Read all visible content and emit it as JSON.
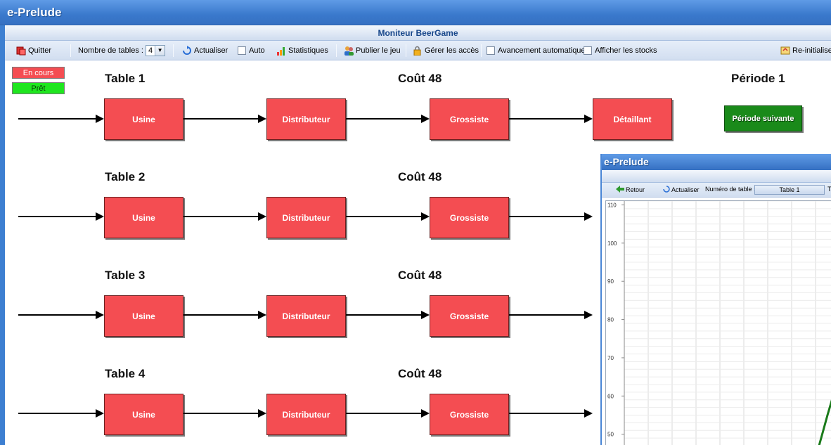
{
  "app": {
    "title": "e-Prelude",
    "subtitle": "Moniteur BeerGame"
  },
  "toolbar": {
    "quit": "Quitter",
    "tables_label": "Nombre de tables :",
    "tables_value": "4",
    "refresh": "Actualiser",
    "auto": "Auto",
    "stats": "Statistiques",
    "publish": "Publier le jeu",
    "access": "Gérer les accès",
    "auto_advance": "Avancement automatique",
    "show_stock": "Afficher les stocks",
    "reset": "Re-initialiser"
  },
  "legend": {
    "in_progress": "En cours",
    "ready": "Prêt"
  },
  "period": {
    "label": "Période 1",
    "next_button": "Période suivante"
  },
  "tables": [
    {
      "label": "Table 1",
      "cost": "Coût 48"
    },
    {
      "label": "Table 2",
      "cost": "Coût 48"
    },
    {
      "label": "Table 3",
      "cost": "Coût 48"
    },
    {
      "label": "Table 4",
      "cost": "Coût 48"
    }
  ],
  "roles": [
    "Usine",
    "Distributeur",
    "Grossiste",
    "Détaillant"
  ],
  "colors": {
    "role_box": "#f44d52",
    "ready": "#1fe61f",
    "next_button": "#1a8a1a",
    "header": "#3a79cc"
  },
  "overlay": {
    "title": "e-Prelude",
    "back": "Retour",
    "refresh": "Actualiser",
    "table_number_label": "Numéro de table :",
    "table_selected": "Table 1",
    "tab_partial": "Ta"
  },
  "chart_data": {
    "type": "line",
    "y_ticks": [
      110,
      100,
      90,
      80,
      70,
      60,
      50
    ],
    "ylim": [
      47,
      111
    ],
    "series": [
      {
        "color": "#1a7a1a",
        "x": [
          0.0,
          0.6,
          1.0
        ],
        "y": [
          47,
          55,
          60
        ]
      }
    ]
  }
}
